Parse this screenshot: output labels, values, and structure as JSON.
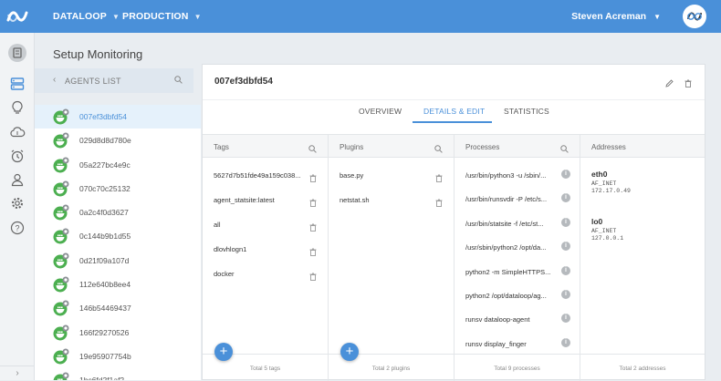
{
  "topbar": {
    "org": "DATALOOP",
    "env": "PRODUCTION",
    "user": "Steven Acreman",
    "bg_color": "#4a90d9"
  },
  "sidebar_icons": [
    "dashboard-icon",
    "agents-icon",
    "insights-icon",
    "cloud-icon",
    "alerts-icon",
    "users-icon",
    "settings-icon",
    "help-icon"
  ],
  "page": {
    "title": "Setup Monitoring"
  },
  "agents": {
    "header": "AGENTS LIST",
    "items": [
      "007ef3dbfd54",
      "029d8d8d780e",
      "05a227bc4e9c",
      "070c70c25132",
      "0a2c4f0d3627",
      "0c144b9b1d55",
      "0d21f09a107d",
      "112e640b8ee4",
      "146b54469437",
      "166f29270526",
      "19e95907754b",
      "1bc6fd2f1af2"
    ],
    "selected_index": 0
  },
  "detail": {
    "title": "007ef3dbfd54",
    "tabs": [
      "OVERVIEW",
      "DETAILS & EDIT",
      "STATISTICS"
    ],
    "active_tab": "DETAILS & EDIT",
    "tags": {
      "header": "Tags",
      "items": [
        "5627d7b51fde49a159c038...",
        "agent_statsite:latest",
        "all",
        "dlovhlogn1",
        "docker"
      ],
      "total": "Total 5 tags"
    },
    "plugins": {
      "header": "Plugins",
      "items": [
        "base.py",
        "netstat.sh"
      ],
      "total": "Total 2 plugins"
    },
    "processes": {
      "header": "Processes",
      "items": [
        "/usr/bin/python3 -u /sbin/...",
        "/usr/bin/runsvdir -P /etc/s...",
        "/usr/bin/statsite -f /etc/st...",
        "/usr/sbin/python2 /opt/da...",
        "python2 -m SimpleHTTPS...",
        "python2 /opt/dataloop/ag...",
        "runsv dataloop-agent",
        "runsv display_finger"
      ],
      "total": "Total 9 processes"
    },
    "addresses": {
      "header": "Addresses",
      "items": [
        {
          "name": "eth0",
          "family": "AF_INET",
          "ip": "172.17.0.49"
        },
        {
          "name": "lo0",
          "family": "AF_INET",
          "ip": "127.0.0.1"
        }
      ],
      "total": "Total 2 addresses"
    }
  }
}
